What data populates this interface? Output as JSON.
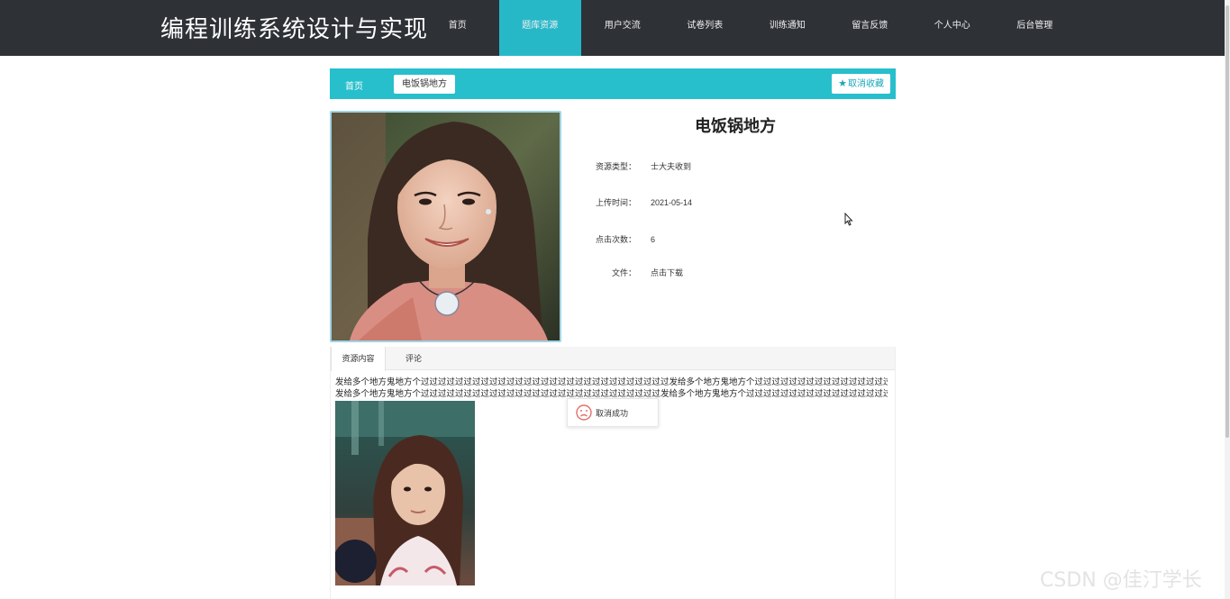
{
  "site": {
    "title": "编程训练系统设计与实现"
  },
  "nav": {
    "items": [
      {
        "label": "首页",
        "active": false
      },
      {
        "label": "题库资源",
        "active": true
      },
      {
        "label": "用户交流",
        "active": false
      },
      {
        "label": "试卷列表",
        "active": false
      },
      {
        "label": "训练通知",
        "active": false
      },
      {
        "label": "留言反馈",
        "active": false
      },
      {
        "label": "个人中心",
        "active": false
      },
      {
        "label": "后台管理",
        "active": false
      }
    ]
  },
  "breadcrumb": {
    "home": "首页",
    "current": "电饭锅地方"
  },
  "favorite_button": {
    "label": "取消收藏",
    "icon": "star-icon"
  },
  "detail": {
    "title": "电饭锅地方",
    "rows": [
      {
        "label": "资源类型：",
        "value": "士大夫收到"
      },
      {
        "label": "上传时间：",
        "value": "2021-05-14"
      },
      {
        "label": "点击次数：",
        "value": "6"
      },
      {
        "label": "文件：",
        "value": "点击下载"
      }
    ]
  },
  "tabs": [
    {
      "label": "资源内容",
      "active": true
    },
    {
      "label": "评论",
      "active": false
    }
  ],
  "content": {
    "lines": [
      "发给多个地方鬼地方个过过过过过过过过过过过过过过过过过过过过过过过过过过过过过发给多个地方鬼地方个过过过过过过过过过过过过过过过过过过过过过过过过过过过过过过过过过",
      "发给多个地方鬼地方个过过过过过过过过过过过过过过过过过过过过过过过过过过过过发给多个地方鬼地方个过过过过过过过过过过过过过过过过过过过过过过过过过过过过过过过过过"
    ]
  },
  "toast": {
    "message": "取消成功",
    "icon": "sad-face-icon"
  },
  "watermark": {
    "text": "CSDN @佳汀学长"
  },
  "colors": {
    "topbar": "#2e3136",
    "accent": "#27bfcc",
    "nav_active": "#27b8c8"
  }
}
